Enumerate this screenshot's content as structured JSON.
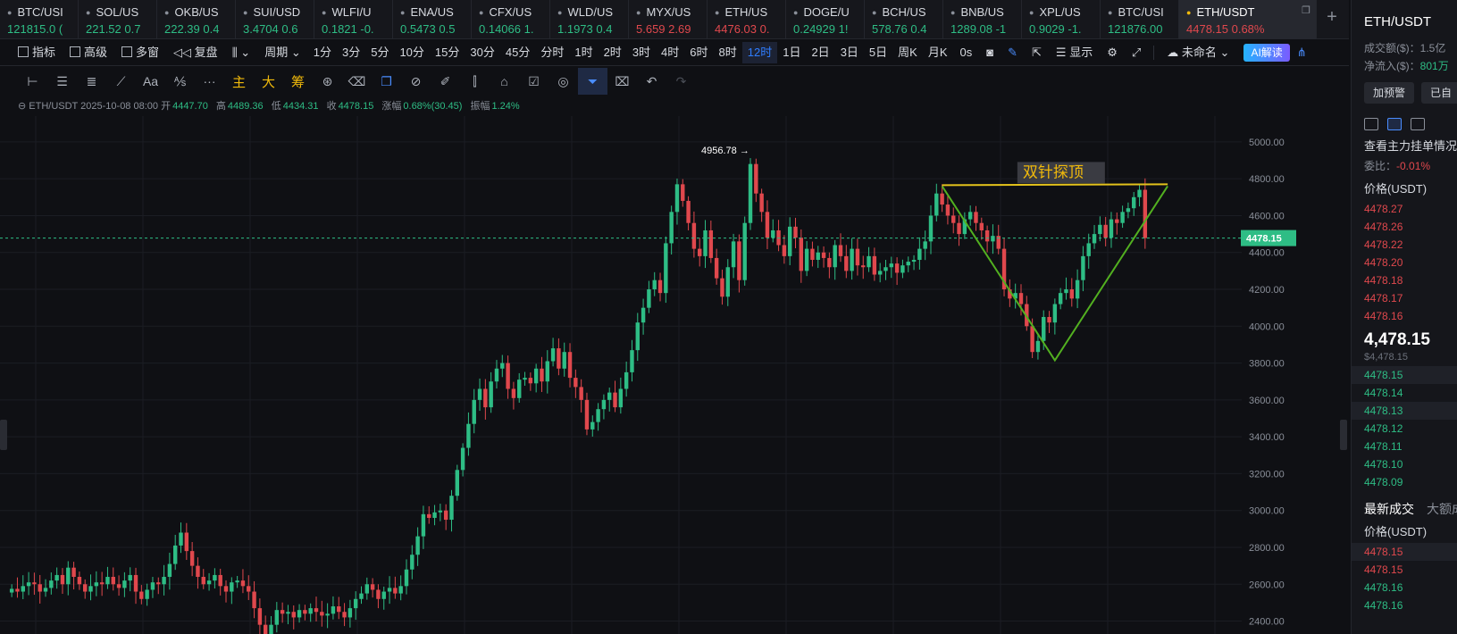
{
  "tabs": [
    {
      "sym": "BTC/USI",
      "px": "121815.0 (",
      "dir": "up"
    },
    {
      "sym": "SOL/US",
      "px": "221.52 0.7",
      "dir": "up"
    },
    {
      "sym": "OKB/US",
      "px": "222.39 0.4",
      "dir": "up"
    },
    {
      "sym": "SUI/USD",
      "px": "3.4704 0.6",
      "dir": "up"
    },
    {
      "sym": "WLFI/U",
      "px": "0.1821 -0.",
      "dir": "up"
    },
    {
      "sym": "ENA/US",
      "px": "0.5473 0.5",
      "dir": "up"
    },
    {
      "sym": "CFX/US",
      "px": "0.14066 1.",
      "dir": "up"
    },
    {
      "sym": "WLD/US",
      "px": "1.1973 0.4",
      "dir": "up"
    },
    {
      "sym": "MYX/US",
      "px": "5.659 2.69",
      "dir": "down"
    },
    {
      "sym": "ETH/US",
      "px": "4476.03 0.",
      "dir": "down"
    },
    {
      "sym": "DOGE/U",
      "px": "0.24929 1!",
      "dir": "up"
    },
    {
      "sym": "BCH/US",
      "px": "578.76 0.4",
      "dir": "up"
    },
    {
      "sym": "BNB/US",
      "px": "1289.08 -1",
      "dir": "up"
    },
    {
      "sym": "XPL/US",
      "px": "0.9029 -1.",
      "dir": "up"
    },
    {
      "sym": "BTC/USI",
      "px": "121876.00",
      "dir": "up"
    },
    {
      "sym": "ETH/USDT",
      "px": "4478.15  0.68%",
      "dir": "down",
      "active": true
    }
  ],
  "toolbar": {
    "indicators": "指标",
    "advanced": "高级",
    "multi_window": "多窗",
    "replay": "复盘",
    "period": "周期",
    "intervals": [
      "1分",
      "3分",
      "5分",
      "10分",
      "15分",
      "30分",
      "45分",
      "分时",
      "1时",
      "2时",
      "3时",
      "4时",
      "6时",
      "8时",
      "12时",
      "1日",
      "2日",
      "3日",
      "5日",
      "周K",
      "月K"
    ],
    "active_interval": "12时",
    "countdown": "0s",
    "display": "显示",
    "unnamed": "未命名",
    "ai": "AI解读"
  },
  "drawbar": {
    "text_tool": "Aa",
    "more": "···",
    "main": "主",
    "big": "大",
    "chips": "筹"
  },
  "ohlc": {
    "symbol": "ETH/USDT",
    "time": "2025-10-08 08:00",
    "open_label": "开",
    "open": "4447.70",
    "high_label": "高",
    "high": "4489.36",
    "low_label": "低",
    "low": "4434.31",
    "close_label": "收",
    "close": "4478.15",
    "change_label": "涨幅",
    "change": "0.68%(30.45)",
    "amp_label": "振幅",
    "amp": "1.24%"
  },
  "chart_data": {
    "type": "candlestick",
    "y_ticks": [
      5000,
      4800,
      4600,
      4400,
      4200,
      4000,
      3800,
      3600,
      3400,
      3200,
      3000,
      2800,
      2600,
      2400
    ],
    "y_tick_labels": [
      "5000.00",
      "4800.00",
      "4600.00",
      "4400.00",
      "4200.00",
      "4000.00",
      "3800.00",
      "3600.00",
      "3400.00",
      "3200.00",
      "3000.00",
      "2800.00",
      "2600.00",
      "2400.00"
    ],
    "ylim": [
      2330,
      5140
    ],
    "last_price": 4478.15,
    "last_price_label": "4478.15",
    "high_marker": {
      "index": 131,
      "value": 4956.78,
      "label": "4956.78 →"
    },
    "annotation": {
      "text": "双针探顶",
      "fill": "#f0b90b"
    },
    "pattern_points": [
      [
        165,
        4760
      ],
      [
        185,
        3815
      ],
      [
        205,
        4760
      ]
    ],
    "pattern_top": [
      [
        165,
        4765
      ],
      [
        205,
        4770
      ]
    ],
    "close_path": [
      2575,
      2560,
      2590,
      2610,
      2600,
      2560,
      2580,
      2620,
      2650,
      2600,
      2690,
      2640,
      2600,
      2560,
      2590,
      2610,
      2600,
      2640,
      2600,
      2580,
      2620,
      2650,
      2560,
      2520,
      2570,
      2610,
      2600,
      2640,
      2710,
      2810,
      2880,
      2780,
      2700,
      2640,
      2600,
      2620,
      2650,
      2590,
      2560,
      2610,
      2620,
      2590,
      2560,
      2470,
      2380,
      2300,
      2380,
      2460,
      2440,
      2450,
      2420,
      2460,
      2440,
      2470,
      2450,
      2430,
      2440,
      2480,
      2450,
      2420,
      2470,
      2520,
      2550,
      2600,
      2570,
      2520,
      2560,
      2580,
      2550,
      2590,
      2680,
      2760,
      2860,
      2980,
      2960,
      2990,
      3000,
      2950,
      3080,
      3220,
      3340,
      3470,
      3600,
      3660,
      3560,
      3700,
      3770,
      3800,
      3660,
      3610,
      3710,
      3720,
      3690,
      3770,
      3700,
      3810,
      3880,
      3770,
      3860,
      3720,
      3670,
      3600,
      3440,
      3480,
      3550,
      3600,
      3640,
      3560,
      3660,
      3750,
      3870,
      4020,
      4100,
      4200,
      4250,
      4180,
      4450,
      4620,
      4770,
      4680,
      4560,
      4420,
      4380,
      4520,
      4370,
      4260,
      4160,
      4320,
      4460,
      4250,
      4560,
      4880,
      4720,
      4620,
      4480,
      4520,
      4440,
      4380,
      4540,
      4480,
      4300,
      4420,
      4360,
      4400,
      4370,
      4320,
      4440,
      4380,
      4300,
      4420,
      4330,
      4320,
      4380,
      4280,
      4300,
      4320,
      4340,
      4290,
      4330,
      4350,
      4360,
      4420,
      4460,
      4600,
      4720,
      4660,
      4600,
      4560,
      4500,
      4580,
      4620,
      4560,
      4520,
      4460,
      4490,
      4420,
      4200,
      4150,
      4180,
      4120,
      4000,
      3860,
      3920,
      4050,
      4020,
      4120,
      4180,
      4200,
      4150,
      4250,
      4380,
      4450,
      4500,
      4550,
      4480,
      4580,
      4560,
      4620,
      4640,
      4700,
      4740,
      4478
    ]
  },
  "panel": {
    "title": "ETH/USDT",
    "turnover_label": "成交额($)：",
    "turnover": "1.5亿",
    "inflow_label": "净流入($)：",
    "inflow": "801万",
    "alert_btn": "加预警",
    "alert_btn2": "已自",
    "orderbook_hint": "查看主力挂单情况",
    "ratio_label": "委比：",
    "ratio": "-0.01%",
    "price_header": "价格(USDT)",
    "asks": [
      "4478.27",
      "4478.26",
      "4478.22",
      "4478.20",
      "4478.18",
      "4478.17",
      "4478.16"
    ],
    "last": "4,478.15",
    "last_usd": "$4,478.15",
    "bids": [
      "4478.15",
      "4478.14",
      "4478.13",
      "4478.12",
      "4478.11",
      "4478.10",
      "4478.09"
    ],
    "trades_tab": "最新成交",
    "big_tab": "大额成",
    "trades_header": "价格(USDT)",
    "trades": [
      {
        "p": "4478.15",
        "dir": "ask"
      },
      {
        "p": "4478.15",
        "dir": "ask"
      },
      {
        "p": "4478.16",
        "dir": "bid"
      },
      {
        "p": "4478.16",
        "dir": "bid"
      }
    ]
  },
  "colors": {
    "up": "#2ebd85",
    "down": "#e0484d",
    "accent": "#2f7dff",
    "pattern": "#52b020",
    "pattern_top": "#e3c21b"
  }
}
